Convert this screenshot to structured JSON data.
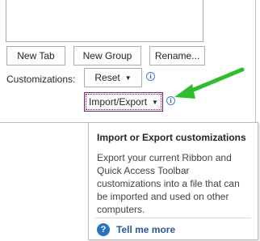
{
  "buttons": {
    "new_tab": "New Tab",
    "new_group": "New Group",
    "rename": "Rename..."
  },
  "customizations": {
    "label": "Customizations:",
    "reset": "Reset",
    "import_export": "Import/Export"
  },
  "tooltip": {
    "title": "Import or Export customizations",
    "body": "Export your current Ribbon and Quick Access Toolbar customizations into a file that can be imported and used on other computers.",
    "help_link": "Tell me more"
  },
  "icons": {
    "info": "info-icon",
    "help": "help-icon",
    "arrow": "green-arrow-icon"
  },
  "colors": {
    "arrow": "#2ebd2e",
    "focus": "#7a1f6e",
    "link": "#2b5a9a"
  }
}
